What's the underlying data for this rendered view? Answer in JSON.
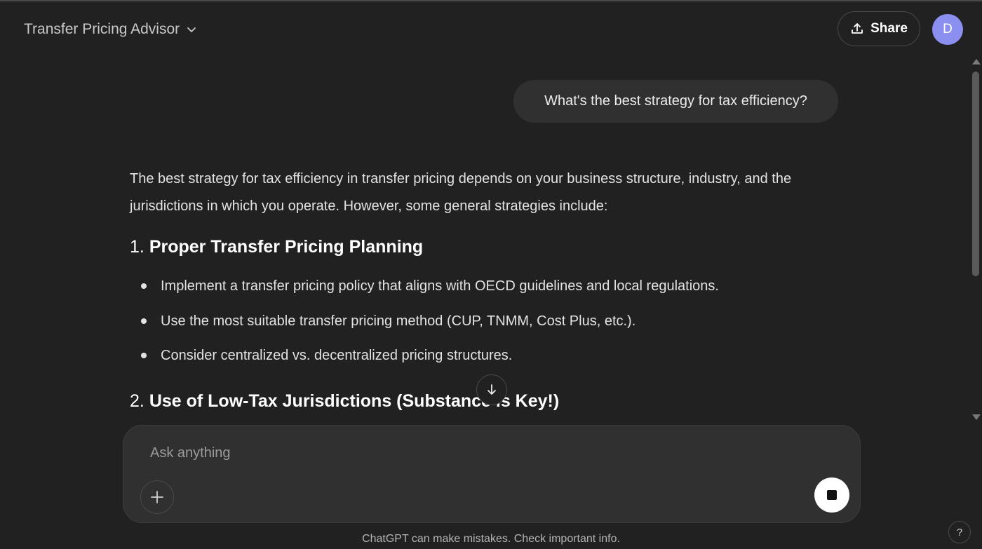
{
  "header": {
    "model_name": "Transfer Pricing Advisor",
    "share_label": "Share",
    "avatar_initial": "D"
  },
  "conversation": {
    "user_message": "What's the best strategy for tax efficiency?",
    "assistant": {
      "intro": "The best strategy for tax efficiency in transfer pricing depends on your business structure, industry, and the jurisdictions in which you operate. However, some general strategies include:",
      "section1": {
        "number": "1.",
        "title": "Proper Transfer Pricing Planning",
        "bullets": [
          "Implement a transfer pricing policy that aligns with OECD guidelines and local regulations.",
          "Use the most suitable transfer pricing method (CUP, TNMM, Cost Plus, etc.).",
          "Consider centralized vs. decentralized pricing structures."
        ]
      },
      "section2": {
        "number": "2.",
        "title": "Use of Low-Tax Jurisdictions (Substance is Key!)"
      }
    }
  },
  "composer": {
    "placeholder": "Ask anything"
  },
  "footer": {
    "disclaimer": "ChatGPT can make mistakes. Check important info.",
    "help_label": "?"
  },
  "icons": {
    "model_selector": "chevron-down-icon",
    "share": "upload-icon",
    "scroll_down": "arrow-down-icon",
    "attach": "plus-icon",
    "stop": "stop-icon"
  },
  "colors": {
    "background": "#212121",
    "user_bubble": "#303030",
    "avatar": "#8a8ff0"
  }
}
